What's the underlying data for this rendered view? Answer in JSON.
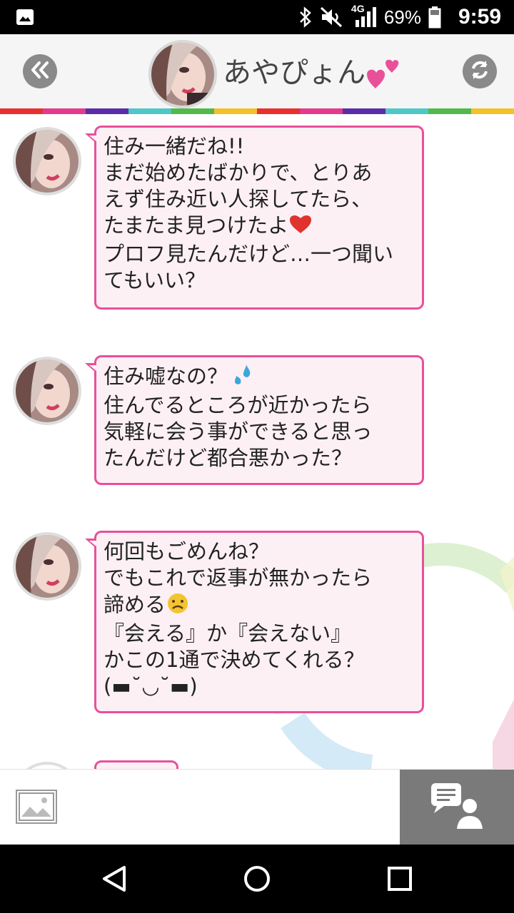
{
  "status_bar": {
    "network": "4G",
    "battery": "69%",
    "time": "9:59",
    "icons": [
      "image-notification-icon",
      "bluetooth-icon",
      "mute-icon",
      "signal-icon",
      "battery-icon"
    ]
  },
  "header": {
    "name": "あやぴょん",
    "back_icon": "double-chevron-left-icon",
    "refresh_icon": "refresh-icon",
    "hearts_icon": "two-hearts-icon"
  },
  "rainbow_colors": [
    "#e8312f",
    "#e43a8d",
    "#5a2ea6",
    "#4fc7c6",
    "#52b94a",
    "#f3c12a",
    "#e8312f",
    "#e43a8d",
    "#5a2ea6",
    "#4fc7c6",
    "#52b94a",
    "#f3c12a"
  ],
  "colors": {
    "bubble_border": "#e8509a",
    "bubble_bg": "#fdf0f4"
  },
  "messages": [
    {
      "lines": [
        "住み一緒だね!!",
        "まだ始めたばかりで、とりあ",
        "えず住み近い人探してたら、",
        "たまたま見つけたよ",
        "プロフ見たんだけど…一つ聞い",
        "てもいい？"
      ],
      "emoji": "red-heart-icon"
    },
    {
      "lines": [
        "住み嘘なの？",
        "住んでるところが近かったら",
        "気軽に会う事ができると思っ",
        "たんだけど都合悪かった？"
      ],
      "emoji": "sweat-drops-icon"
    },
    {
      "lines": [
        "何回もごめんね？",
        "でもこれで返事が無かったら",
        "諦める",
        "『会える』か『会えない』",
        "かこの1通で決めてくれる？",
        "(▬˘◡˘▬)"
      ],
      "emoji": "sad-face-icon"
    }
  ],
  "input_bar": {
    "image_button_icon": "image-icon",
    "action_button_icon": "chat-user-icon"
  },
  "nav_bar": {
    "icons": [
      "back-triangle-icon",
      "home-circle-icon",
      "recents-square-icon"
    ]
  }
}
